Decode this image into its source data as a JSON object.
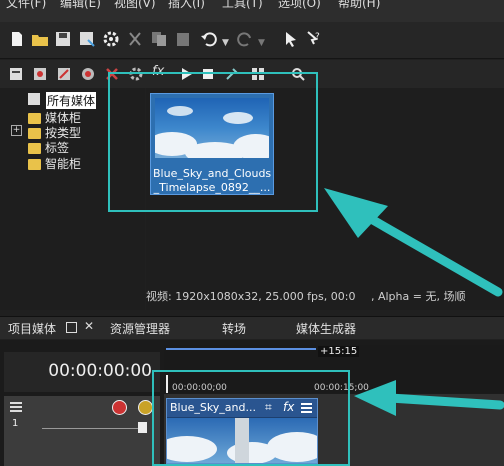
{
  "menu": [
    "文件(F)",
    "编辑(E)",
    "视图(V)",
    "插入(I)",
    "工具(T)",
    "选项(O)",
    "帮助(H)"
  ],
  "toolbar_icons": [
    "new-file-icon",
    "open-folder-icon",
    "save-icon",
    "save-as-icon",
    "properties-gear-icon",
    "copy-icon",
    "paste-icon",
    "undo-icon",
    "redo-icon",
    "cursor-icon",
    "help-icon"
  ],
  "media_toolbar_icons": [
    "import-media-icon",
    "capture-icon",
    "get-media-icon",
    "web-icon",
    "delete-icon",
    "settings-icon",
    "fx-icon",
    "play-icon",
    "stop-icon",
    "auto-preview-icon",
    "views-icon",
    "zoom-icon"
  ],
  "tree": {
    "root": "所有媒体",
    "items": [
      "媒体柜",
      "按类型",
      "标签",
      "智能柜"
    ]
  },
  "media": {
    "clip_name_line1": "Blue_Sky_and_Clouds",
    "clip_name_line2": "_Timelapse_0892__..."
  },
  "status": {
    "text": "视频: 1920x1080x32, 25.000 fps, 00:0",
    "text2": ", Alpha = 无, 场顺"
  },
  "tabs": [
    "项目媒体",
    "资源管理器",
    "转场",
    "媒体生成器"
  ],
  "timeline": {
    "timecode": "00:00:00:00",
    "ruler_start": "00:00:00;00",
    "ruler_mid": "00:00:15;00",
    "duration_badge": "+15:15",
    "clip_label": "Blue_Sky_and...",
    "track_number": "1"
  },
  "colors": {
    "highlight": "#2fc0bc",
    "folder": "#e9c24a",
    "selection": "#2d6fb0"
  }
}
